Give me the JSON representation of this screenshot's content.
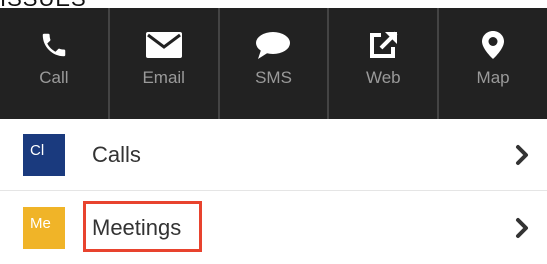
{
  "top_partial_text": "ISSUES",
  "actions": [
    {
      "label": "Call",
      "icon": "phone-icon"
    },
    {
      "label": "Email",
      "icon": "envelope-icon"
    },
    {
      "label": "SMS",
      "icon": "chat-bubble-icon"
    },
    {
      "label": "Web",
      "icon": "external-link-icon"
    },
    {
      "label": "Map",
      "icon": "map-pin-icon"
    }
  ],
  "related": [
    {
      "badge": "Cl",
      "label": "Calls",
      "badge_color": "#1a3a7e"
    },
    {
      "badge": "Me",
      "label": "Meetings",
      "badge_color": "#f0b428"
    }
  ],
  "colors": {
    "action_bar_bg": "#222222",
    "highlight": "#e8432e"
  }
}
